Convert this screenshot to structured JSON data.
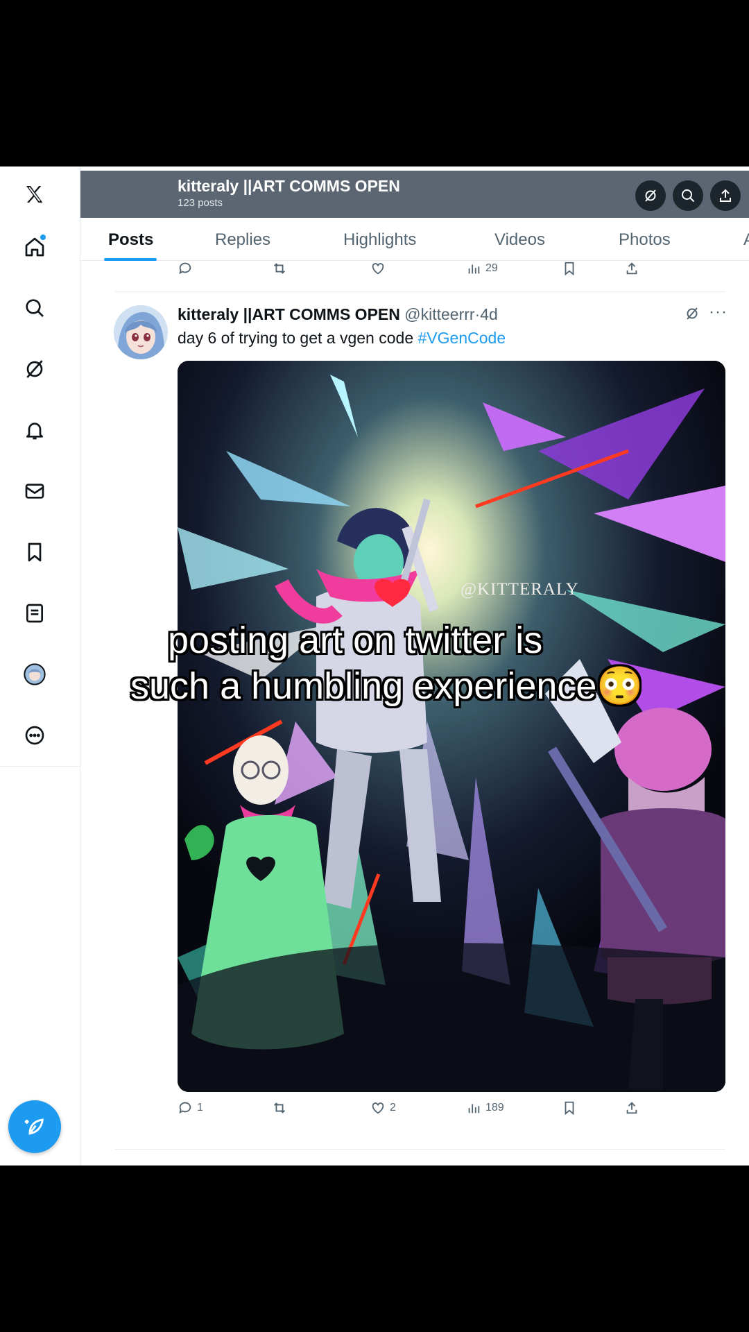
{
  "header": {
    "name": "kitteraly ||ART COMMS OPEN",
    "post_count": "123 posts"
  },
  "tabs": [
    "Posts",
    "Replies",
    "Highlights",
    "Videos",
    "Photos",
    "A"
  ],
  "nav_icons": [
    "x-logo-icon",
    "home-icon",
    "search-icon",
    "grok-icon",
    "notifications-icon",
    "messages-icon",
    "bookmarks-icon",
    "lists-icon",
    "profile-avatar",
    "more-icon",
    "compose-icon"
  ],
  "prev_post": {
    "views": "29"
  },
  "post": {
    "name": "kitteraly ||ART COMMS OPEN",
    "handle": "@kitteerrr",
    "separator": "·",
    "time": "4d",
    "text": "day 6 of trying to get a vgen code ",
    "hashtag": "#VGenCode",
    "watermark": "@KITTERALY",
    "replies": "1",
    "likes": "2",
    "views": "189"
  },
  "caption": {
    "line1": "posting art on twitter is",
    "line2": "such a humbling experience😳"
  },
  "colors": {
    "accent": "#1d9bf0",
    "text": "#0f1419",
    "muted": "#536471",
    "header_bg": "#5b6672"
  }
}
